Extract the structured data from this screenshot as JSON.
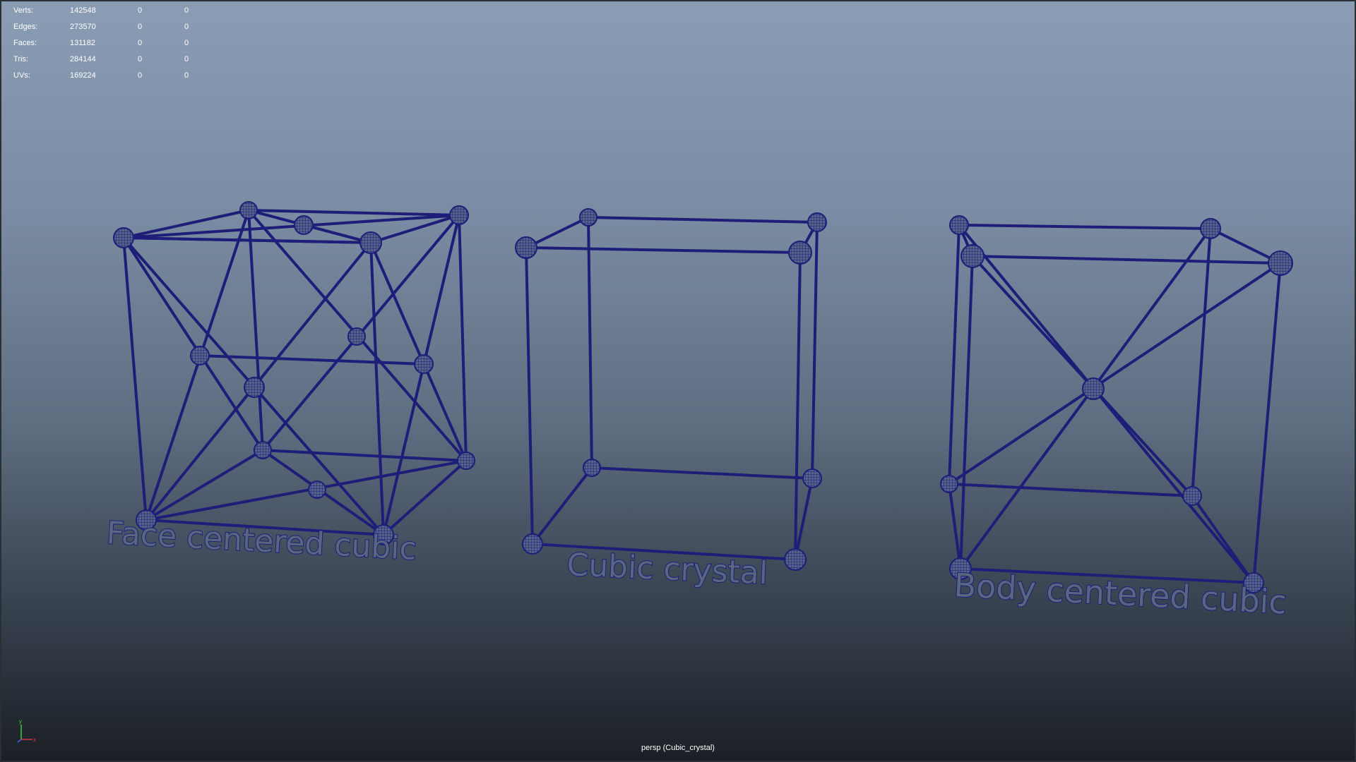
{
  "viewport": {
    "camera_label": "persp (Cubic_crystal)"
  },
  "hud": {
    "rows": [
      {
        "label": "Verts:",
        "v1": "142548",
        "v2": "0",
        "v3": "0"
      },
      {
        "label": "Edges:",
        "v1": "273570",
        "v2": "0",
        "v3": "0"
      },
      {
        "label": "Faces:",
        "v1": "131182",
        "v2": "0",
        "v3": "0"
      },
      {
        "label": "Tris:",
        "v1": "284144",
        "v2": "0",
        "v3": "0"
      },
      {
        "label": "UVs:",
        "v1": "169224",
        "v2": "0",
        "v3": "0"
      }
    ]
  },
  "models": {
    "fcc_label": "Face centered cubic",
    "sc_label": "Cubic  crystal",
    "bcc_label": "Body centered cubic"
  },
  "axis": {
    "y": "y",
    "x": "x"
  },
  "colors": {
    "wire": "#1e1e78",
    "sphere_fill": "#5a6888",
    "axis_y": "#3fcf3f",
    "axis_x": "#d23a3a",
    "axis_z": "#3f5fff"
  }
}
